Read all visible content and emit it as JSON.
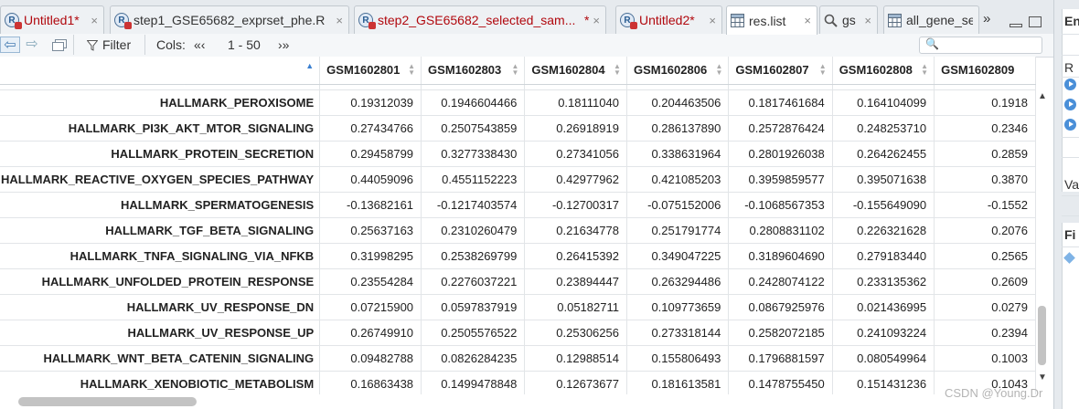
{
  "tabs": [
    {
      "label": "Untitled1*",
      "icon": "r-script-icon",
      "modified": true,
      "active": false
    },
    {
      "label": "step1_GSE65682_exprset_phe.R",
      "icon": "r-script-icon",
      "modified": false,
      "active": false
    },
    {
      "label": "step2_GSE65682_selected_sam...",
      "icon": "r-script-icon",
      "modified": true,
      "active": false,
      "modified_mark": "*"
    },
    {
      "label": "Untitled2*",
      "icon": "r-script-icon",
      "modified": true,
      "active": false
    },
    {
      "label": "res.list",
      "icon": "data-grid-icon",
      "modified": false,
      "active": true
    },
    {
      "label": "gs",
      "icon": "search-icon",
      "modified": false,
      "active": false
    },
    {
      "label": "all_gene_set",
      "icon": "data-grid-icon",
      "modified": false,
      "active": false
    }
  ],
  "tab_overflow": "»",
  "close_glyph": "×",
  "toolbar": {
    "filter_label": "Filter",
    "cols_label": "Cols:",
    "cols_prev": "«‹",
    "cols_range": "1 - 50",
    "cols_next": "›»",
    "search_placeholder": "🔍"
  },
  "table": {
    "columns": [
      "",
      "GSM1602801",
      "GSM1602803",
      "GSM1602804",
      "GSM1602806",
      "GSM1602807",
      "GSM1602808",
      "GSM1602809"
    ],
    "rows": [
      {
        "name": "HALLMARK_PEROXISOME",
        "values": [
          "0.19312039",
          "0.1946604466",
          "0.18111040",
          "0.204463506",
          "0.1817461684",
          "0.164104099",
          "0.1918"
        ]
      },
      {
        "name": "HALLMARK_PI3K_AKT_MTOR_SIGNALING",
        "values": [
          "0.27434766",
          "0.2507543859",
          "0.26918919",
          "0.286137890",
          "0.2572876424",
          "0.248253710",
          "0.2346"
        ]
      },
      {
        "name": "HALLMARK_PROTEIN_SECRETION",
        "values": [
          "0.29458799",
          "0.3277338430",
          "0.27341056",
          "0.338631964",
          "0.2801926038",
          "0.264262455",
          "0.2859"
        ]
      },
      {
        "name": "HALLMARK_REACTIVE_OXYGEN_SPECIES_PATHWAY",
        "values": [
          "0.44059096",
          "0.4551152223",
          "0.42977962",
          "0.421085203",
          "0.3959859577",
          "0.395071638",
          "0.3870"
        ]
      },
      {
        "name": "HALLMARK_SPERMATOGENESIS",
        "values": [
          "-0.13682161",
          "-0.1217403574",
          "-0.12700317",
          "-0.075152006",
          "-0.1068567353",
          "-0.155649090",
          "-0.1552"
        ]
      },
      {
        "name": "HALLMARK_TGF_BETA_SIGNALING",
        "values": [
          "0.25637163",
          "0.2310260479",
          "0.21634778",
          "0.251791774",
          "0.2808831102",
          "0.226321628",
          "0.2076"
        ]
      },
      {
        "name": "HALLMARK_TNFA_SIGNALING_VIA_NFKB",
        "values": [
          "0.31998295",
          "0.2538269799",
          "0.26415392",
          "0.349047225",
          "0.3189604690",
          "0.279183440",
          "0.2565"
        ]
      },
      {
        "name": "HALLMARK_UNFOLDED_PROTEIN_RESPONSE",
        "values": [
          "0.23554284",
          "0.2276037221",
          "0.23894447",
          "0.263294486",
          "0.2428074122",
          "0.233135362",
          "0.2609"
        ]
      },
      {
        "name": "HALLMARK_UV_RESPONSE_DN",
        "values": [
          "0.07215900",
          "0.0597837919",
          "0.05182711",
          "0.109773659",
          "0.0867925976",
          "0.021436995",
          "0.0279"
        ]
      },
      {
        "name": "HALLMARK_UV_RESPONSE_UP",
        "values": [
          "0.26749910",
          "0.2505576522",
          "0.25306256",
          "0.273318144",
          "0.2582072185",
          "0.241093224",
          "0.2394"
        ]
      },
      {
        "name": "HALLMARK_WNT_BETA_CATENIN_SIGNALING",
        "values": [
          "0.09482788",
          "0.0826284235",
          "0.12988514",
          "0.155806493",
          "0.1796881597",
          "0.080549964",
          "0.1003"
        ]
      },
      {
        "name": "HALLMARK_XENOBIOTIC_METABOLISM",
        "values": [
          "0.16863438",
          "0.1499478848",
          "0.12673677",
          "0.181613581",
          "0.1478755450",
          "0.151431236",
          "0.1043"
        ]
      }
    ]
  },
  "right_pane": {
    "env_tab_partial": "En",
    "r_label_partial": "R",
    "values_label_partial": "Va",
    "files_label_partial": "Fi"
  },
  "watermark": "CSDN @Young.Dr",
  "colors": {
    "modified_tab_text": "#b1080e",
    "sort_indicator": "#3a7fd0"
  }
}
